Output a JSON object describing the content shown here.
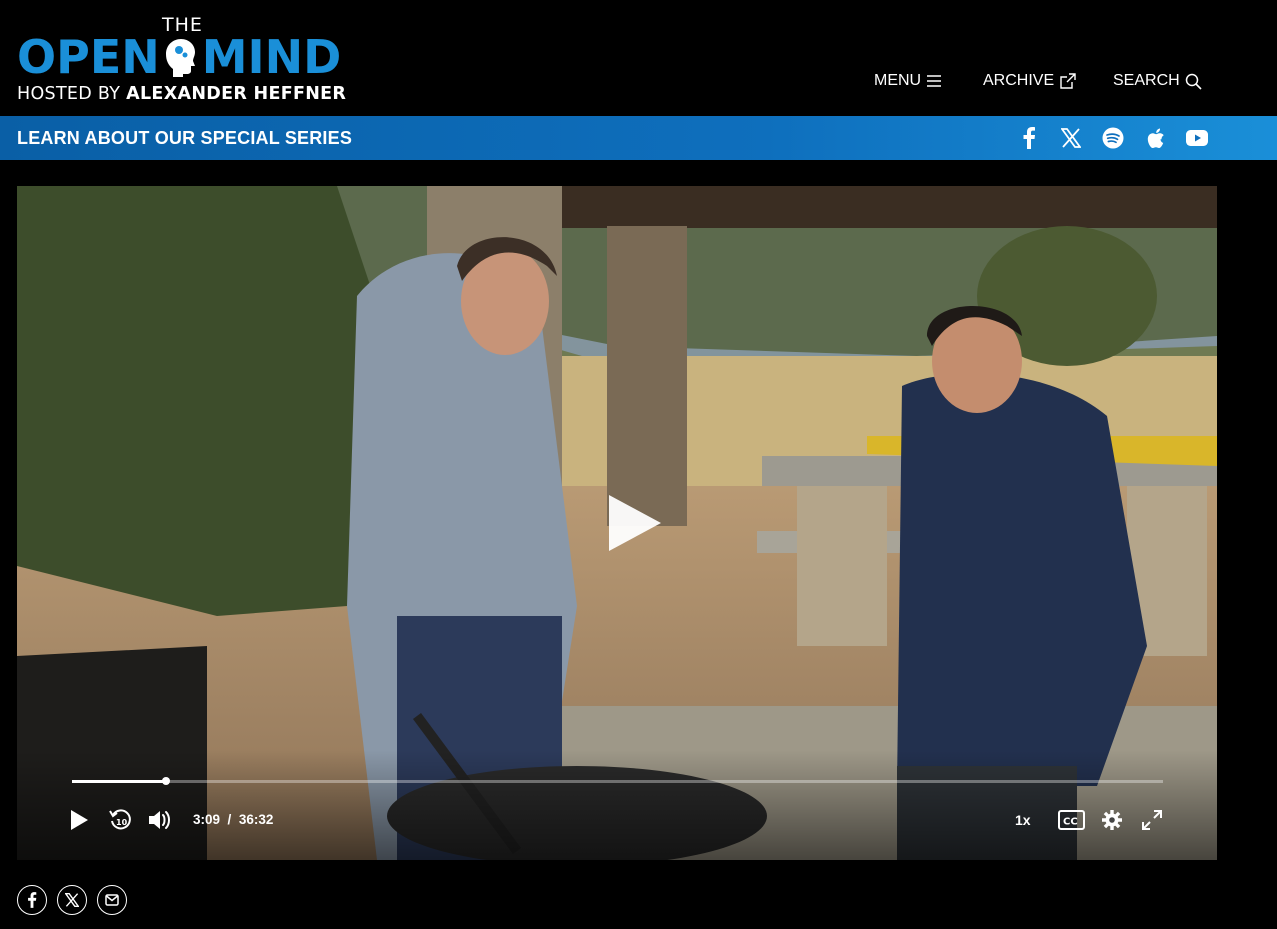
{
  "logo": {
    "the": "THE",
    "word_open": "OPEN",
    "word_mind": "MIND",
    "hosted_by": "HOSTED BY",
    "host": "ALEXANDER HEFFNER"
  },
  "nav": {
    "menu": "MENU",
    "archive": "ARCHIVE",
    "search": "SEARCH"
  },
  "banner": {
    "series_link": "LEARN ABOUT OUR SPECIAL SERIES"
  },
  "social_icons": [
    "facebook-icon",
    "x-icon",
    "spotify-icon",
    "apple-icon",
    "youtube-icon"
  ],
  "player": {
    "current_time": "3:09",
    "separator": "/",
    "duration": "36:32",
    "speed": "1x",
    "progress": 0.0862
  },
  "share_icons": [
    "facebook-icon",
    "x-icon",
    "email-icon"
  ],
  "colors": {
    "brand_blue": "#1a8fd8",
    "banner_blue": "#0e6fbd",
    "background": "#000000"
  }
}
